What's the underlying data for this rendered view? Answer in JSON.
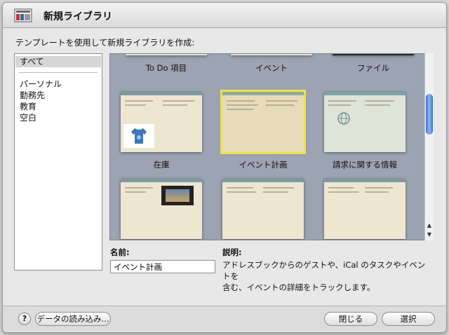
{
  "window": {
    "title": "新規ライブラリ",
    "title_icon": "library-icon"
  },
  "instruction": "テンプレートを使用して新規ライブラリを作成:",
  "sidebar": {
    "items": [
      {
        "label": "すべて",
        "selected": true
      },
      {
        "label": "パーソナル"
      },
      {
        "label": "勤務先"
      },
      {
        "label": "教育"
      },
      {
        "label": "空白"
      }
    ]
  },
  "gallery": {
    "templates": [
      {
        "label": "To Do 項目"
      },
      {
        "label": "イベント"
      },
      {
        "label": "ファイル"
      },
      {
        "label": "在庫"
      },
      {
        "label": "イベント計画",
        "selected": true
      },
      {
        "label": "請求に関する情報"
      },
      {
        "label": ""
      },
      {
        "label": ""
      },
      {
        "label": ""
      }
    ]
  },
  "details": {
    "name_label": "名前:",
    "name_value": "イベント計画",
    "description_label": "説明:",
    "description_line1": "アドレスブックからのゲストや、iCal のタスクやイベントを",
    "description_line2": "含む、イベントの詳細をトラックします。"
  },
  "footer": {
    "help_label": "?",
    "import_label": "データの読み込み...",
    "close_label": "閉じる",
    "choose_label": "選択"
  }
}
